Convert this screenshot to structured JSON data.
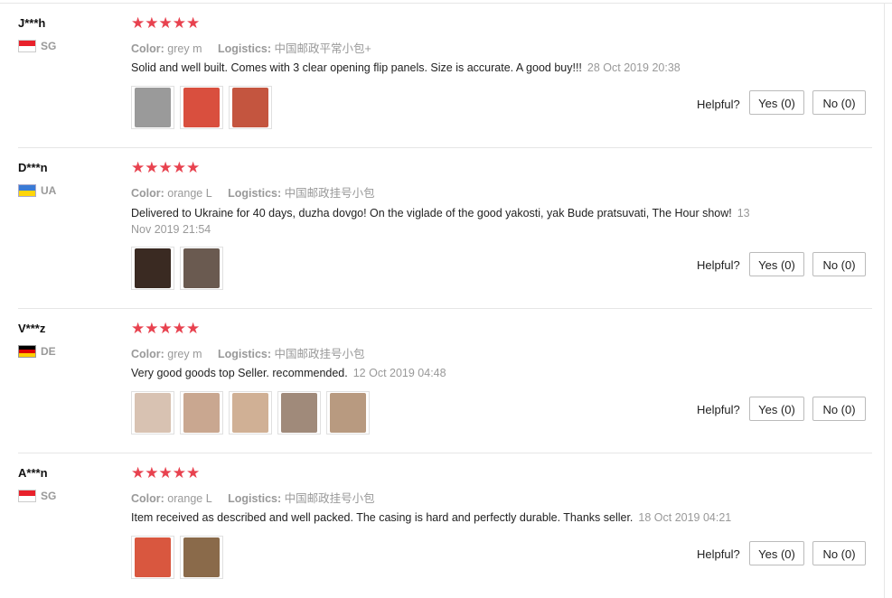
{
  "helpful_label": "Helpful?",
  "reviews": [
    {
      "user": "J***h",
      "country": "SG",
      "stars": "★★★★★",
      "color_label": "Color:",
      "color_value": "grey m",
      "logistics_label": "Logistics:",
      "logistics_value": "中国邮政平常小包+",
      "text": "Solid and well built. Comes with 3 clear opening flip panels. Size is accurate. A good buy!!!",
      "date": "28 Oct 2019 20:38",
      "yes_label": "Yes (0)",
      "no_label": "No (0)",
      "photo_colors": [
        "#9a9a9a",
        "#d94f3e",
        "#c4553f"
      ]
    },
    {
      "user": "D***n",
      "country": "UA",
      "stars": "★★★★★",
      "color_label": "Color:",
      "color_value": "orange L",
      "logistics_label": "Logistics:",
      "logistics_value": "中国邮政挂号小包",
      "text": "Delivered to Ukraine for 40 days, duzha dovgo! On the viglade of the good yakosti, yak Bude pratsuvati, The Hour show!",
      "date": "13 Nov 2019 21:54",
      "yes_label": "Yes (0)",
      "no_label": "No (0)",
      "photo_colors": [
        "#3a2a22",
        "#6a5a50"
      ]
    },
    {
      "user": "V***z",
      "country": "DE",
      "stars": "★★★★★",
      "color_label": "Color:",
      "color_value": "grey m",
      "logistics_label": "Logistics:",
      "logistics_value": "中国邮政挂号小包",
      "text": "Very good goods top Seller. recommended.",
      "date": "12 Oct 2019 04:48",
      "yes_label": "Yes (0)",
      "no_label": "No (0)",
      "photo_colors": [
        "#d8c2b2",
        "#c9a790",
        "#d0b095",
        "#a08a7a",
        "#b89a80"
      ]
    },
    {
      "user": "A***n",
      "country": "SG",
      "stars": "★★★★★",
      "color_label": "Color:",
      "color_value": "orange L",
      "logistics_label": "Logistics:",
      "logistics_value": "中国邮政挂号小包",
      "text": "Item received as described and well packed. The casing is hard and perfectly durable. Thanks seller.",
      "date": "18 Oct 2019 04:21",
      "yes_label": "Yes (0)",
      "no_label": "No (0)",
      "photo_colors": [
        "#d9573f",
        "#8a6a4a"
      ]
    }
  ]
}
